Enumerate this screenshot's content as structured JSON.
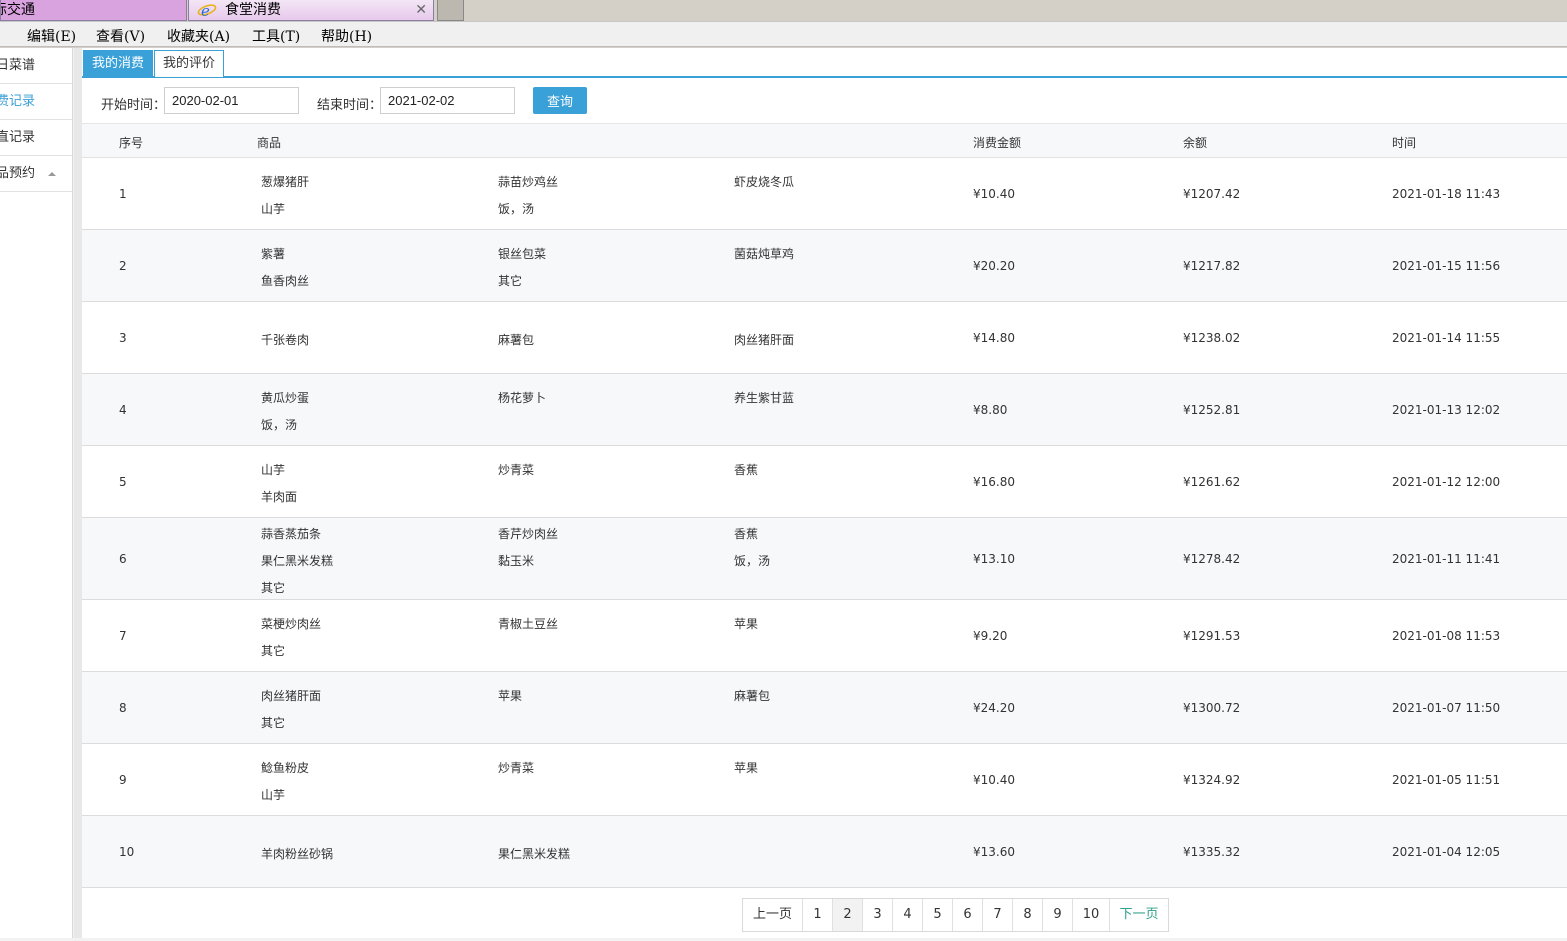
{
  "browser": {
    "tabs": [
      {
        "title": "际交通"
      },
      {
        "title": "食堂消费",
        "close": "✕"
      }
    ],
    "menu": [
      "  )",
      "编辑(E)",
      "查看(V)",
      "收藏夹(A)",
      "工具(T)",
      "帮助(H)"
    ]
  },
  "sidebar": {
    "items": [
      {
        "label": "日菜谱"
      },
      {
        "label": "费记录"
      },
      {
        "label": "直记录"
      },
      {
        "label": "品预约"
      }
    ]
  },
  "subtabs": [
    "我的消费",
    "我的评价"
  ],
  "filter": {
    "start_label": "开始时间：",
    "start_value": "2020-02-01",
    "end_label": "结束时间：",
    "end_value": "2021-02-02",
    "query_button": "查询"
  },
  "table": {
    "headers": {
      "no": "序号",
      "goods": "商品",
      "amount": "消费金额",
      "balance": "余额",
      "time": "时间"
    },
    "rows": [
      {
        "no": "1",
        "items": [
          "葱爆猪肝",
          "蒜苗炒鸡丝",
          "虾皮烧冬瓜",
          "山芋",
          "饭，汤"
        ],
        "amount": "¥10.40",
        "balance": "¥1207.42",
        "time": "2021-01-18 11:43"
      },
      {
        "no": "2",
        "items": [
          "紫薯",
          "银丝包菜",
          "菌菇炖草鸡",
          "鱼香肉丝",
          "其它"
        ],
        "amount": "¥20.20",
        "balance": "¥1217.82",
        "time": "2021-01-15 11:56"
      },
      {
        "no": "3",
        "items": [
          "千张卷肉",
          "麻薯包",
          "肉丝猪肝面"
        ],
        "amount": "¥14.80",
        "balance": "¥1238.02",
        "time": "2021-01-14 11:55"
      },
      {
        "no": "4",
        "items": [
          "黄瓜炒蛋",
          "杨花萝卜",
          "养生紫甘蓝",
          "饭，汤"
        ],
        "amount": "¥8.80",
        "balance": "¥1252.81",
        "time": "2021-01-13 12:02"
      },
      {
        "no": "5",
        "items": [
          "山芋",
          "炒青菜",
          "香蕉",
          "羊肉面"
        ],
        "amount": "¥16.80",
        "balance": "¥1261.62",
        "time": "2021-01-12 12:00"
      },
      {
        "no": "6",
        "items": [
          "蒜香蒸茄条",
          "香芹炒肉丝",
          "香蕉",
          "果仁黑米发糕",
          "黏玉米",
          "饭，汤",
          "其它"
        ],
        "amount": "¥13.10",
        "balance": "¥1278.42",
        "time": "2021-01-11 11:41"
      },
      {
        "no": "7",
        "items": [
          "菜梗炒肉丝",
          "青椒土豆丝",
          "苹果",
          "其它"
        ],
        "amount": "¥9.20",
        "balance": "¥1291.53",
        "time": "2021-01-08 11:53"
      },
      {
        "no": "8",
        "items": [
          "肉丝猪肝面",
          "苹果",
          "麻薯包",
          "其它"
        ],
        "amount": "¥24.20",
        "balance": "¥1300.72",
        "time": "2021-01-07 11:50"
      },
      {
        "no": "9",
        "items": [
          "鲶鱼粉皮",
          "炒青菜",
          "苹果",
          "山芋"
        ],
        "amount": "¥10.40",
        "balance": "¥1324.92",
        "time": "2021-01-05 11:51"
      },
      {
        "no": "10",
        "items": [
          "羊肉粉丝砂锅",
          "果仁黑米发糕"
        ],
        "amount": "¥13.60",
        "balance": "¥1335.32",
        "time": "2021-01-04 12:05"
      }
    ]
  },
  "pager": {
    "prev": "上一页",
    "pages": [
      "1",
      "2",
      "3",
      "4",
      "5",
      "6",
      "7",
      "8",
      "9",
      "10"
    ],
    "current": "2",
    "next": "下一页"
  }
}
